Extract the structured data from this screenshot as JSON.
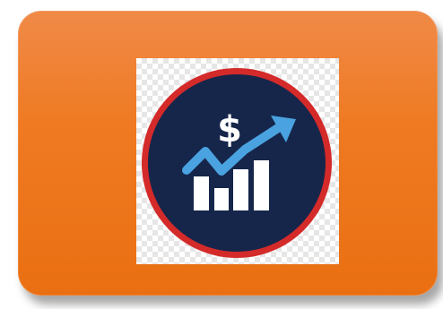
{
  "tile": {
    "color": "#ef7a22"
  },
  "icon": {
    "name": "growth-chart-dollar-icon",
    "symbol": "$",
    "circle_fill": "#16264a",
    "ring_color": "#d42a2a",
    "bar_color": "#ffffff",
    "arrow_color": "#4aa3e0"
  }
}
